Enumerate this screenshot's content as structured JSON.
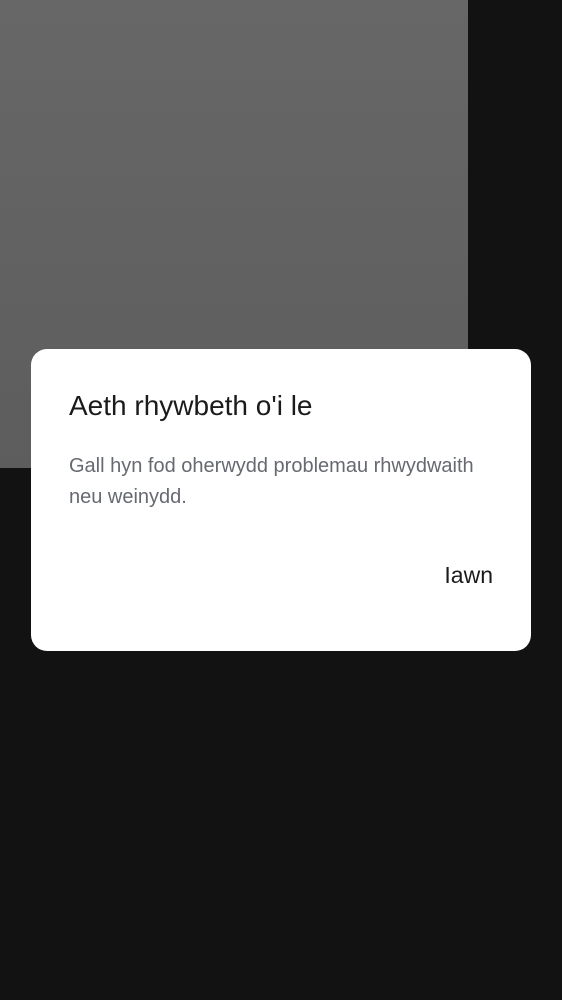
{
  "dialog": {
    "title": "Aeth rhywbeth o'i le",
    "message": "Gall hyn fod oherwydd problemau rhwydwaith neu weinydd.",
    "confirm_label": "Iawn"
  },
  "colors": {
    "background": "#121212",
    "backdrop_panel": "#616161",
    "dialog_surface": "#ffffff",
    "title_text": "#1b1b1d",
    "message_text": "#666a70"
  }
}
